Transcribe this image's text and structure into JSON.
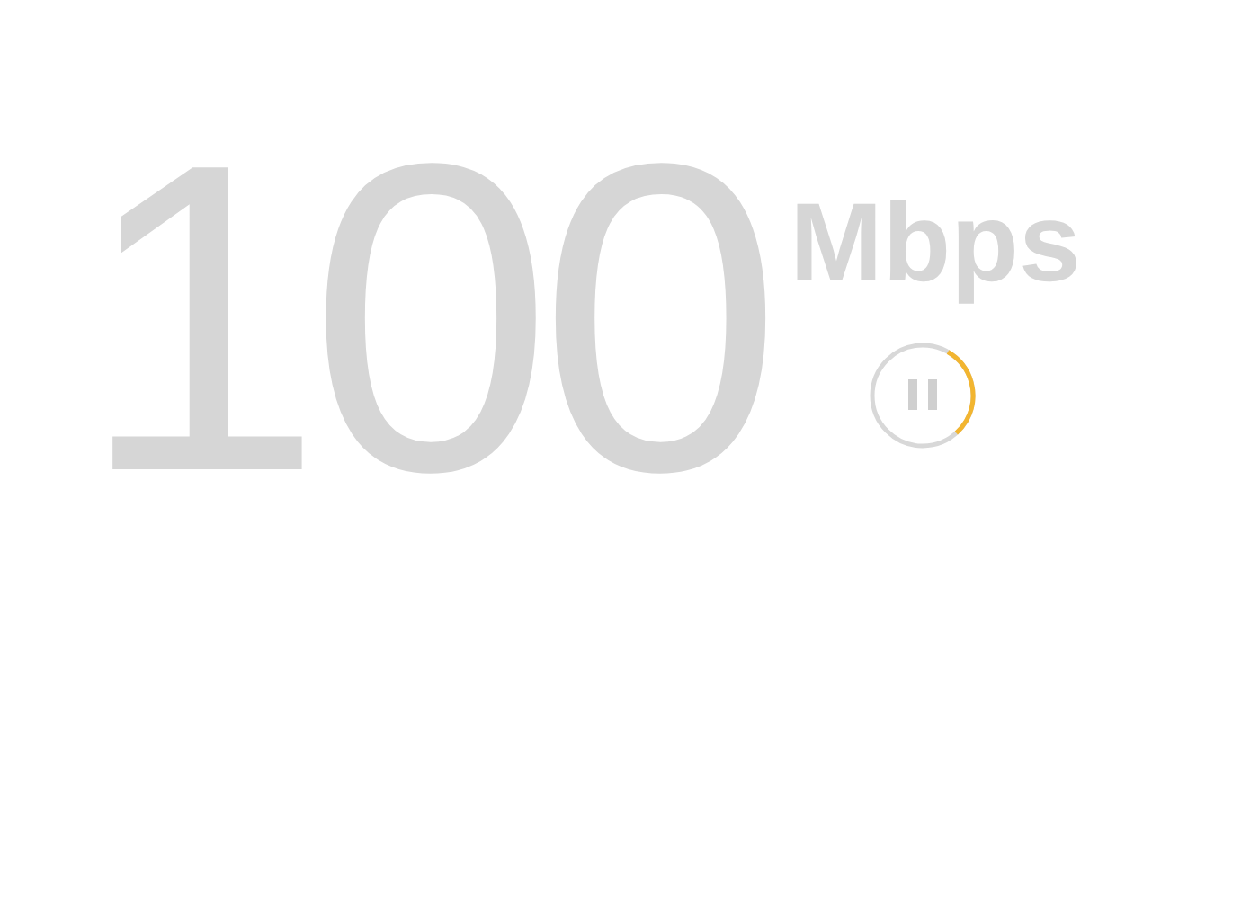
{
  "speed": {
    "value": "100",
    "unit": "Mbps"
  }
}
